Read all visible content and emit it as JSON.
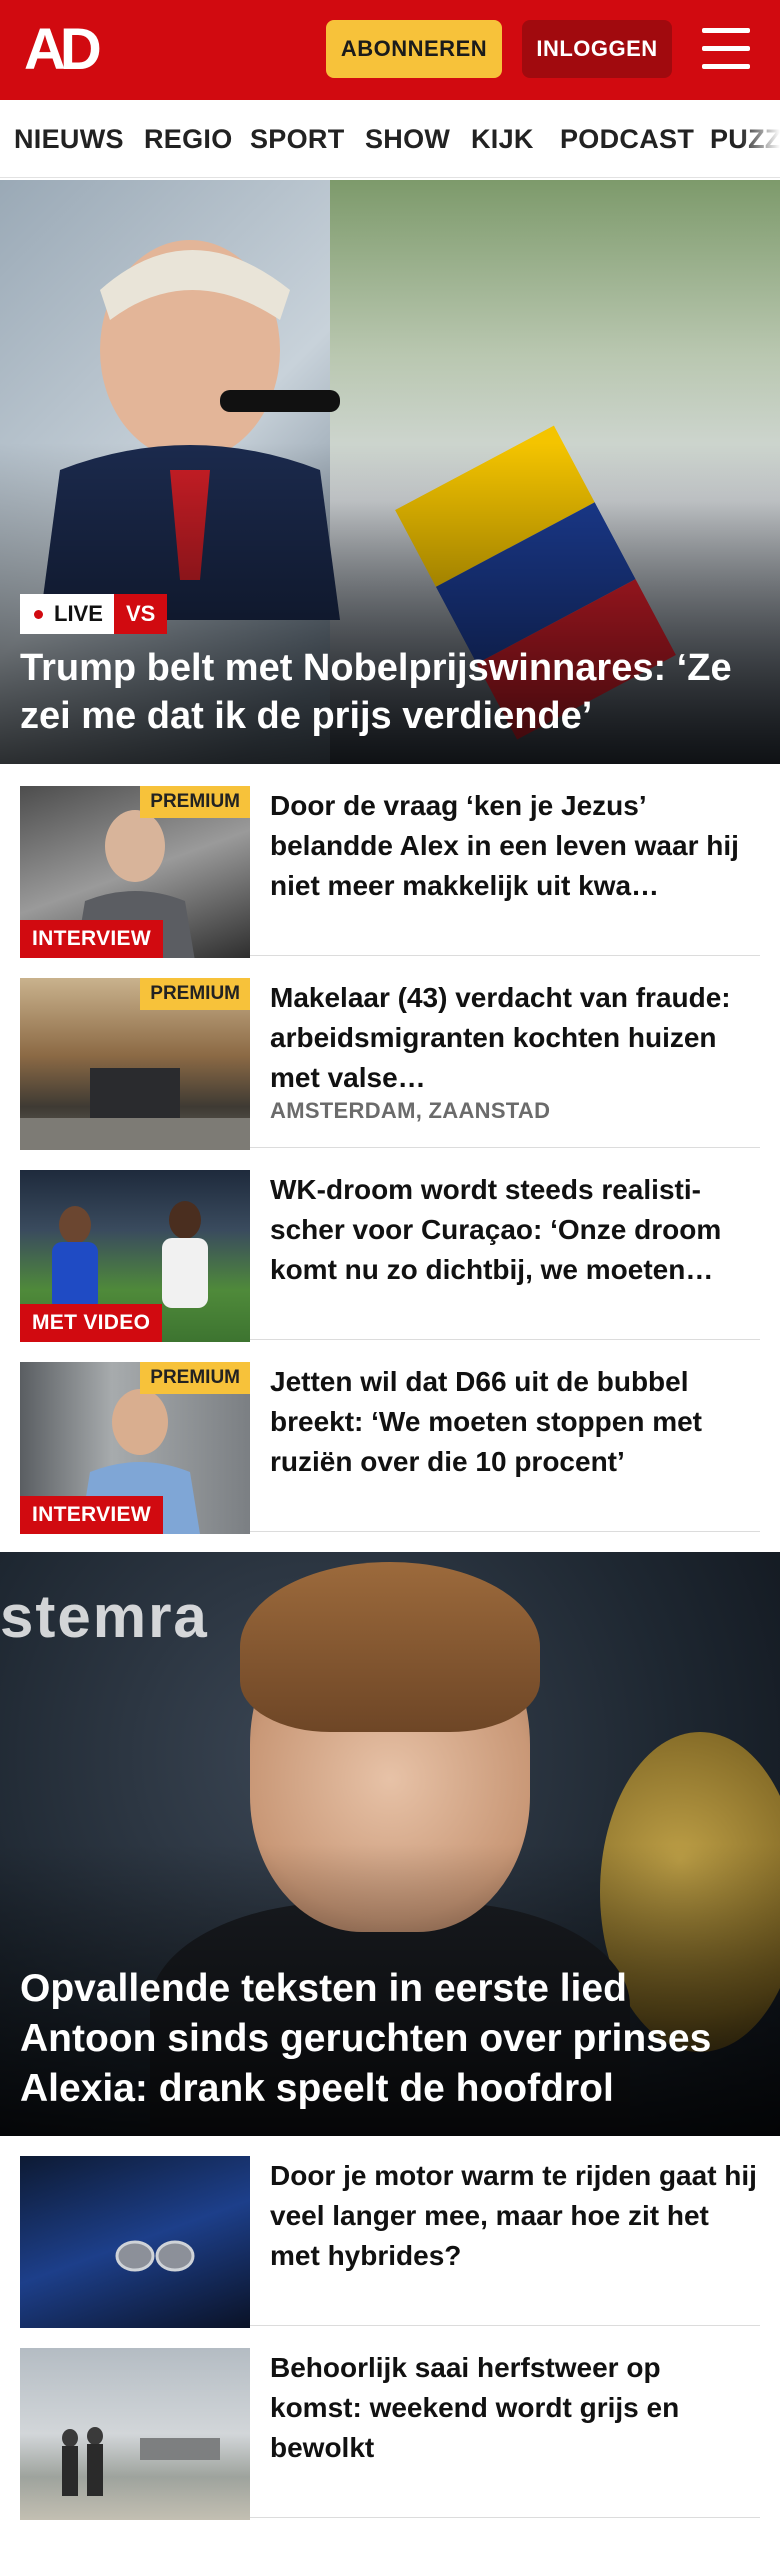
{
  "header": {
    "logo_text": "AD",
    "subscribe_label": "ABONNEREN",
    "login_label": "INLOGGEN",
    "menu_icon": "hamburger-menu-icon",
    "brand_color": "#d10a10",
    "accent_color": "#f7c23a"
  },
  "nav": {
    "items": [
      "NIEUWS",
      "REGIO",
      "SPORT",
      "SHOW",
      "KIJK",
      "PODCAST",
      "PUZZ"
    ]
  },
  "hero1": {
    "live_label": "LIVE",
    "vs_label": "VS",
    "title": "Trump belt met Nobelprijswinnares: ‘Ze zei me dat ik de prijs verdiende’"
  },
  "articles1": [
    {
      "title": "Door de vraag ‘ken je Jezus’ belandde Alex in een leven waar hij niet meer makkelijk uit kwa…",
      "premium": "PREMIUM",
      "tag": "INTERVIEW",
      "location": ""
    },
    {
      "title": "Makelaar (43) verdacht van fraude: arbeidsmigranten kochten huizen met valse…",
      "premium": "PREMIUM",
      "tag": "",
      "location": "AMSTERDAM, ZAANSTAD"
    },
    {
      "title": "WK-droom wordt steeds realisti-scher voor Curaçao: ‘Onze droom komt nu zo dichtbij, we moeten…",
      "premium": "",
      "tag": "MET VIDEO",
      "location": ""
    },
    {
      "title": "Jetten wil dat D66 uit de bubbel breekt: ‘We moeten stoppen met ruziën over die 10 procent’",
      "premium": "PREMIUM",
      "tag": "INTERVIEW",
      "location": ""
    }
  ],
  "hero2": {
    "backdrop_text": "stemra",
    "title": "Opvallende teksten in eerste lied Antoon sinds geruchten over prinses Alexia: drank speelt de hoofdrol"
  },
  "articles2": [
    {
      "title": "Door je motor warm te rijden gaat hij veel langer mee, maar hoe zit het met hybrides?"
    },
    {
      "title": "Behoorlijk saai herfstweer op komst: weekend wordt grijs en bewolkt"
    }
  ]
}
